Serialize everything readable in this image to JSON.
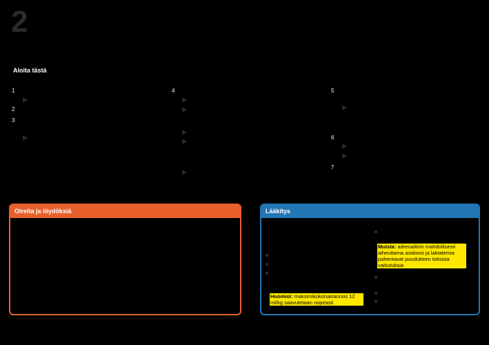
{
  "page": {
    "step_number": "2",
    "start_label": "Aloita tästä"
  },
  "steps": {
    "col1": [
      "1",
      "2",
      "3"
    ],
    "col2": [
      "4"
    ],
    "col3": [
      "5",
      "6",
      "7"
    ]
  },
  "panels": {
    "symptoms": {
      "title": "Oireita ja löydöksiä",
      "color": "#e8612c"
    },
    "medication": {
      "title": "Lääkitys",
      "color": "#2276b4",
      "note_label": "Huomioi:",
      "note_text": " maksimikokonaisannos 12 ml/kg saavutetaan nopeasti",
      "remember_label": "Muista:",
      "remember_text": " adrenaliinin mahdollisesti aiheuttama asidoosi ja laktatemia pahentavat puudutteen toksisia vaikutuksia"
    }
  },
  "colors": {
    "highlight": "#ffe800",
    "background": "#000000"
  }
}
